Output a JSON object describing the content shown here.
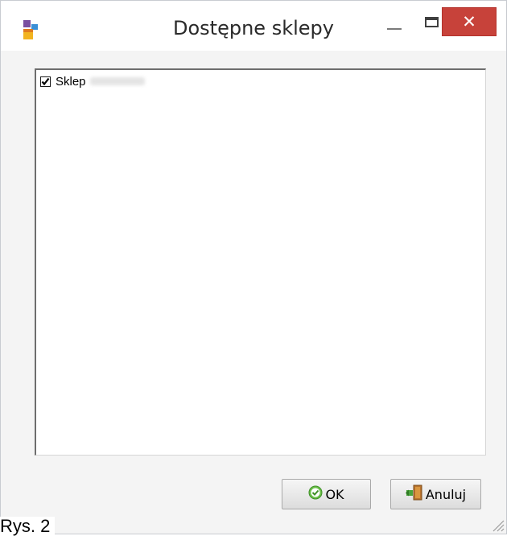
{
  "window": {
    "title": "Dostępne sklepy",
    "controls": [
      "minimize",
      "maximize",
      "close"
    ],
    "close_glyph": "✕",
    "accent_close": "#c7423a"
  },
  "list": {
    "items": [
      {
        "label": "Sklep",
        "checked": true
      }
    ]
  },
  "buttons": {
    "ok_label": "OK",
    "cancel_label": "Anuluj"
  },
  "icons": {
    "app": "app-icon",
    "ok": "check-circle-icon",
    "cancel": "exit-door-icon",
    "resize": "resize-grip-icon"
  },
  "caption": "Rys. 2"
}
